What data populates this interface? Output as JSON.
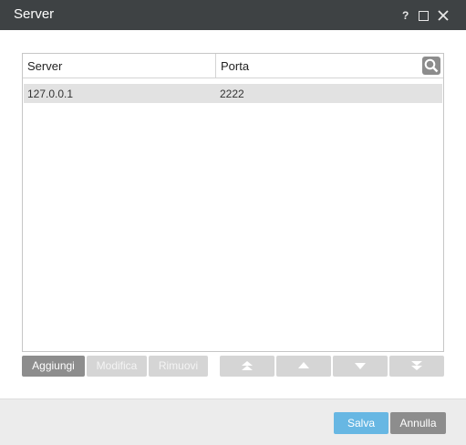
{
  "window": {
    "title": "Server",
    "help_label": "?"
  },
  "table": {
    "columns": [
      "Server",
      "Porta"
    ],
    "rows": [
      {
        "server": "127.0.0.1",
        "porta": "2222"
      }
    ]
  },
  "actions": {
    "add_label": "Aggiungi",
    "edit_label": "Modifica",
    "remove_label": "Rimuovi"
  },
  "footer": {
    "save_label": "Salva",
    "cancel_label": "Annulla"
  },
  "colors": {
    "titlebar": "#3e4244",
    "primary": "#67b7e3",
    "secondary_button": "#8d8d8d",
    "disabled_button": "#d5d5d5",
    "selected_row": "#e2e2e2"
  },
  "icons": [
    "search-icon",
    "move-top-icon",
    "move-up-icon",
    "move-down-icon",
    "move-bottom-icon",
    "maximize-icon",
    "close-icon",
    "help-icon"
  ]
}
